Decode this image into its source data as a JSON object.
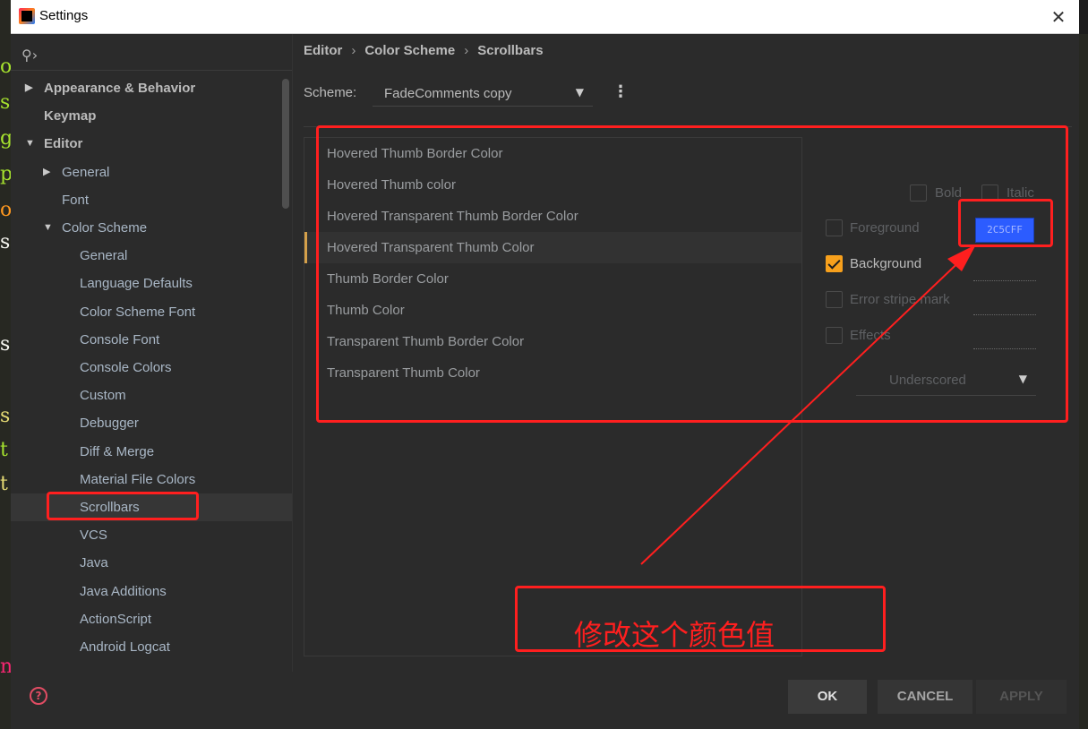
{
  "window": {
    "title": "Settings"
  },
  "sidebar": {
    "items": [
      {
        "label": "Appearance & Behavior",
        "level": 0,
        "arrow": "▶",
        "bold": true
      },
      {
        "label": "Keymap",
        "level": 0,
        "arrow": "",
        "bold": true
      },
      {
        "label": "Editor",
        "level": 0,
        "arrow": "▼",
        "bold": true
      },
      {
        "label": "General",
        "level": 1,
        "arrow": "▶"
      },
      {
        "label": "Font",
        "level": 1,
        "arrow": ""
      },
      {
        "label": "Color Scheme",
        "level": 1,
        "arrow": "▼"
      },
      {
        "label": "General",
        "level": 2
      },
      {
        "label": "Language Defaults",
        "level": 2
      },
      {
        "label": "Color Scheme Font",
        "level": 2
      },
      {
        "label": "Console Font",
        "level": 2
      },
      {
        "label": "Console Colors",
        "level": 2
      },
      {
        "label": "Custom",
        "level": 2
      },
      {
        "label": "Debugger",
        "level": 2
      },
      {
        "label": "Diff & Merge",
        "level": 2
      },
      {
        "label": "Material File Colors",
        "level": 2
      },
      {
        "label": "Scrollbars",
        "level": 2,
        "selected": true
      },
      {
        "label": "VCS",
        "level": 2
      },
      {
        "label": "Java",
        "level": 2
      },
      {
        "label": "Java Additions",
        "level": 2
      },
      {
        "label": "ActionScript",
        "level": 2
      },
      {
        "label": "Android Logcat",
        "level": 2
      }
    ]
  },
  "breadcrumb": {
    "a": "Editor",
    "b": "Color Scheme",
    "c": "Scrollbars",
    "sep": "›"
  },
  "scheme": {
    "label": "Scheme:",
    "value": "FadeComments copy"
  },
  "attributes": [
    "Hovered Thumb Border Color",
    "Hovered Thumb color",
    "Hovered Transparent Thumb Border Color",
    "Hovered Transparent Thumb Color",
    "Thumb Border Color",
    "Thumb Color",
    "Transparent Thumb Border Color",
    "Transparent Thumb Color"
  ],
  "selected_attribute_index": 3,
  "options": {
    "bold": "Bold",
    "italic": "Italic",
    "foreground": "Foreground",
    "background": "Background",
    "background_value": "2C5CFF",
    "error_stripe": "Error stripe mark",
    "effects": "Effects",
    "effect_type": "Underscored"
  },
  "footer": {
    "ok": "OK",
    "cancel": "CANCEL",
    "apply": "APPLY"
  },
  "annotation": {
    "text": "修改这个颜色值",
    "color": "#ff1f1f"
  },
  "colors": {
    "accent": "#f7a01c",
    "swatch": "#2c5cff"
  }
}
